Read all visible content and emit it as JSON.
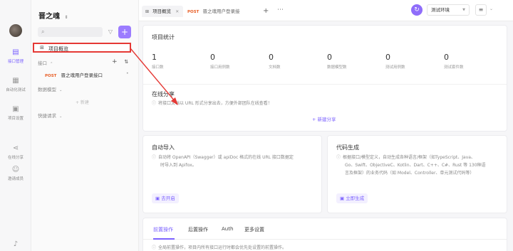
{
  "sidebar_rail": {
    "items": [
      {
        "label": "接口管理",
        "icon": "api-icon",
        "active": true
      },
      {
        "label": "自动化测试",
        "icon": "test-icon",
        "active": false
      },
      {
        "label": "项目设置",
        "icon": "settings-icon",
        "active": false
      },
      {
        "label": "在线分享",
        "icon": "share-icon",
        "active": false
      },
      {
        "label": "邀请成员",
        "icon": "invite-icon",
        "active": false
      }
    ],
    "bottom_icon": "bell-icon"
  },
  "project_panel": {
    "title": "晋之魂",
    "title_caret": "⌃",
    "overview_label": "项目概览",
    "api_section_label": "接口",
    "api_item": {
      "method": "POST",
      "name": "晋之魂用户登录接口"
    },
    "model_section_label": "数据模型",
    "new_model_label": "+ 新建",
    "shortcut_section_label": "快捷请求"
  },
  "tabs": [
    {
      "label": "项目概览",
      "active": true
    },
    {
      "method": "POST",
      "label": "晋之魂用户登录接",
      "active": false
    }
  ],
  "toolbar": {
    "environment": "测试环境"
  },
  "stats": {
    "title": "项目统计",
    "items": [
      {
        "value": "1",
        "label": "接口数"
      },
      {
        "value": "0",
        "label": "接口用例数"
      },
      {
        "value": "0",
        "label": "文档数"
      },
      {
        "value": "0",
        "label": "数据模型数"
      },
      {
        "value": "0",
        "label": "测试用例数"
      },
      {
        "value": "0",
        "label": "测试套件数"
      }
    ]
  },
  "share": {
    "title": "在线分享",
    "desc": "将接口文档以 URL 形式分享出去，方便外部团队在线查看！",
    "action": "+ 新建分享"
  },
  "import": {
    "title": "自动导入",
    "desc_line1": "自动将 OpenAPI（Swagger）或 apiDoc 格式的在线 URL 接口数据定",
    "desc_line2": "时导入到 Apifox。",
    "action": "去开启"
  },
  "codegen": {
    "title": "代码生成",
    "desc_line1": "根据接口/模型定义，自动生成各种语言/框架（如TypeScript、Java、",
    "desc_line2": "Go、Swift、ObjectiveC、Kotlin、Dart、C++、C#、Rust 等 130种语",
    "desc_line3": "言及框架）的业务代码（如 Model、Controller、单元测试代码等）",
    "action": "立即生成"
  },
  "bottom_tabs": {
    "tabs": [
      "前置操作",
      "后置操作",
      "Auth",
      "更多设置"
    ],
    "hint": "全局前置操作，项目内所有接口运行时都会优先处设置的前置操作。"
  },
  "colors": {
    "accent": "#7b61ff",
    "post": "#e85d24",
    "annotation": "#e53935"
  }
}
